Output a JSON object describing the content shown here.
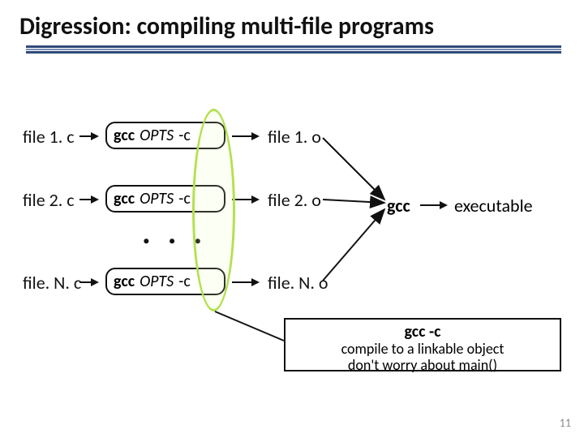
{
  "title": "Digression: compiling multi-file programs",
  "sources": {
    "0": "file 1. c",
    "1": "file 2. c",
    "2": "file. N. c"
  },
  "commands": {
    "gcc": "gcc",
    "opts": "OPTS",
    "flag": "-c"
  },
  "objects": {
    "0": "file 1. o",
    "1": "file 2. o",
    "2": "file. N. o"
  },
  "ellipsis": ". . .",
  "linker_label": "gcc",
  "exec_label": "executable",
  "callout": {
    "title_bold": "gcc  -c",
    "line1": "compile to a linkable object",
    "line2": "don't worry about main()"
  },
  "page_number": "11"
}
